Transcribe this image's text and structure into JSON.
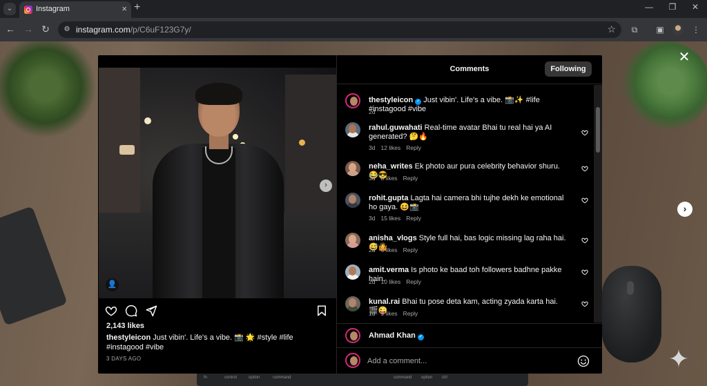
{
  "browser": {
    "tab_title": "Instagram",
    "url_host": "instagram.com",
    "url_path": "/p/C6uF123G7y/"
  },
  "post": {
    "likes": "2,143 likes",
    "caption_user": "thestyleicon",
    "caption_text": " Just vibin'. Life's a vibe. 📸 🌟 #style #life #instagood #vibe",
    "date": "3 DAYS AGO"
  },
  "comments_panel": {
    "title": "Comments",
    "following_label": "Following",
    "comments": [
      {
        "user": "thestyleicon",
        "verified": true,
        "text": " Just vibin'. Life's a vibe. 📸✨ #life #instagood #vibe",
        "time": "2d",
        "likes": "",
        "reply": "",
        "heart": false
      },
      {
        "user": "rahul.guwahati",
        "verified": false,
        "text": " Real-time avatar Bhai tu real hai ya AI generated? 🤔🔥",
        "time": "3d",
        "likes": "12 likes",
        "reply": "Reply",
        "heart": true
      },
      {
        "user": "neha_writes",
        "verified": false,
        "text": " Ek photo aur pura celebrity behavior shuru. 😂😎",
        "time": "3d",
        "likes": "8 likes",
        "reply": "Reply",
        "heart": true
      },
      {
        "user": "rohit.gupta",
        "verified": false,
        "text": " Lagta hai camera bhi tujhe dekh ke emotional ho gaya. 😆📸",
        "time": "3d",
        "likes": "15 likes",
        "reply": "Reply",
        "heart": true
      },
      {
        "user": "anisha_vlogs",
        "verified": false,
        "text": " Style full hai, bas logic missing lag raha hai. 😅🤷",
        "time": "2d",
        "likes": "6 likes",
        "reply": "Reply",
        "heart": true
      },
      {
        "user": "amit.verma",
        "verified": false,
        "text": " Is photo ke baad toh followers badhne pakke hain.",
        "time": "2d",
        "likes": "10 likes",
        "reply": "Reply",
        "heart": true
      },
      {
        "user": "kunal.rai",
        "verified": false,
        "text": " Bhai tu pose deta kam, acting zyada karta hai. 🎬😜",
        "time": "1d",
        "likes": "9 likes",
        "reply": "Reply",
        "heart": true
      }
    ],
    "current_user": "Ahmad Khan",
    "comment_placeholder": "Add a comment..."
  },
  "desk": {
    "key_labels": [
      "fn",
      "control",
      "option",
      "command",
      "command",
      "option",
      "ctrl"
    ]
  },
  "colors": {
    "verified_blue": "#0095f6",
    "story_ring": "#d62976",
    "panel_bg": "#000000"
  }
}
